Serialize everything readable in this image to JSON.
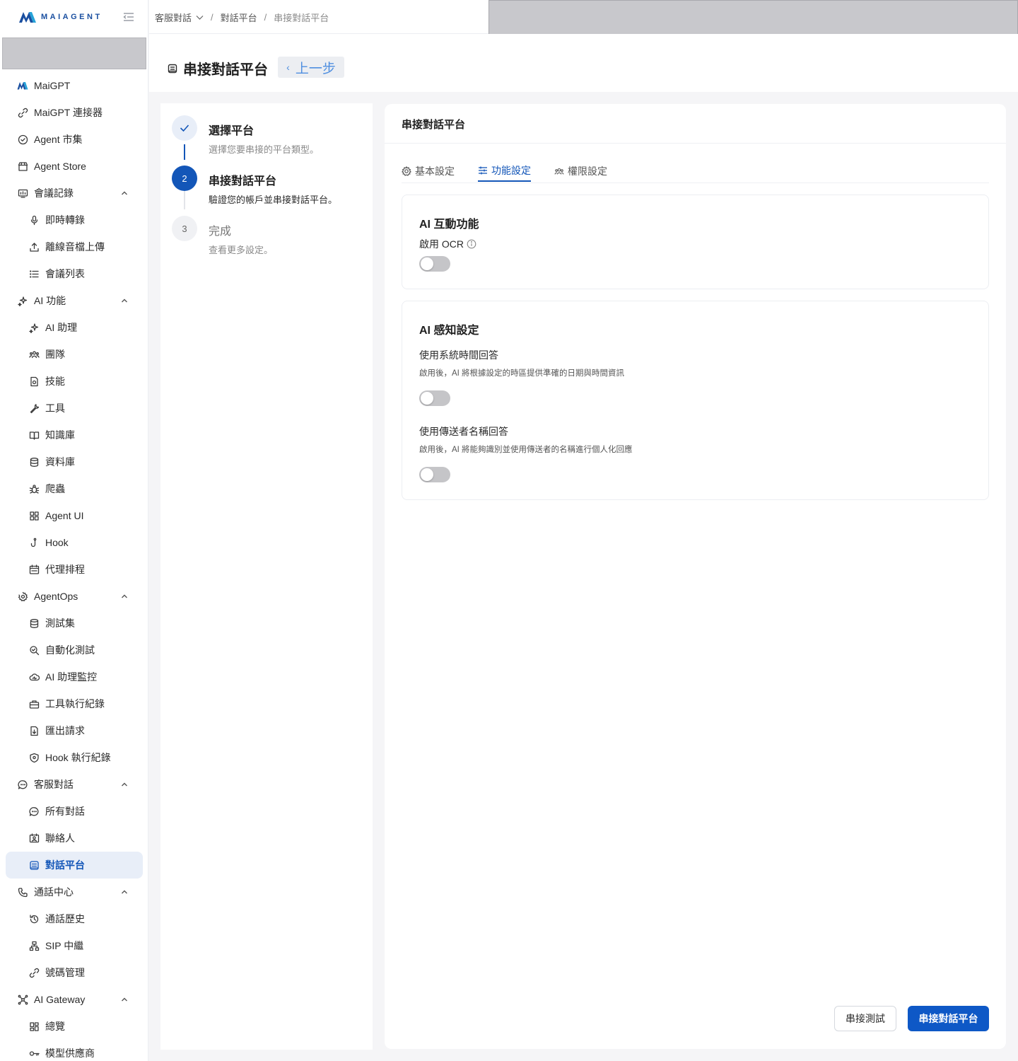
{
  "logo": {
    "text": "MAIAGENT"
  },
  "sidebar": {
    "items": [
      {
        "label": "MaiGPT",
        "icon": "maigpt-logo-icon",
        "level": 1
      },
      {
        "label": "MaiGPT 連接器",
        "icon": "link-icon",
        "level": 1
      },
      {
        "label": "Agent 市集",
        "icon": "badge-check-icon",
        "level": 1
      },
      {
        "label": "Agent Store",
        "icon": "store-icon",
        "level": 1
      },
      {
        "label": "會議記錄",
        "icon": "meeting-icon",
        "level": 1,
        "expanded": true
      },
      {
        "label": "即時轉錄",
        "icon": "microphone-icon",
        "level": 2
      },
      {
        "label": "離線音檔上傳",
        "icon": "upload-icon",
        "level": 2
      },
      {
        "label": "會議列表",
        "icon": "list-icon",
        "level": 2
      },
      {
        "label": "AI 功能",
        "icon": "sparkles-icon",
        "level": 1,
        "expanded": true
      },
      {
        "label": "AI 助理",
        "icon": "sparkles-icon",
        "level": 2
      },
      {
        "label": "團隊",
        "icon": "team-icon",
        "level": 2
      },
      {
        "label": "技能",
        "icon": "skill-file-icon",
        "level": 2
      },
      {
        "label": "工具",
        "icon": "wrench-icon",
        "level": 2
      },
      {
        "label": "知識庫",
        "icon": "book-icon",
        "level": 2
      },
      {
        "label": "資料庫",
        "icon": "database-icon",
        "level": 2
      },
      {
        "label": "爬蟲",
        "icon": "bug-icon",
        "level": 2
      },
      {
        "label": "Agent UI",
        "icon": "grid-icon",
        "level": 2
      },
      {
        "label": "Hook",
        "icon": "hook-icon",
        "level": 2
      },
      {
        "label": "代理排程",
        "icon": "calendar-icon",
        "level": 2
      },
      {
        "label": "AgentOps",
        "icon": "gear-cycle-icon",
        "level": 1,
        "expanded": true
      },
      {
        "label": "測試集",
        "icon": "database-icon",
        "level": 2
      },
      {
        "label": "自動化測試",
        "icon": "search-check-icon",
        "level": 2
      },
      {
        "label": "AI 助理監控",
        "icon": "cloud-monitor-icon",
        "level": 2
      },
      {
        "label": "工具執行紀錄",
        "icon": "toolbox-icon",
        "level": 2
      },
      {
        "label": "匯出請求",
        "icon": "export-file-icon",
        "level": 2
      },
      {
        "label": "Hook 執行紀錄",
        "icon": "shield-icon",
        "level": 2
      },
      {
        "label": "客服對話",
        "icon": "chat-icon",
        "level": 1,
        "expanded": true
      },
      {
        "label": "所有對話",
        "icon": "chat-icon",
        "level": 2
      },
      {
        "label": "聯絡人",
        "icon": "contact-icon",
        "level": 2
      },
      {
        "label": "對話平台",
        "icon": "platform-icon",
        "level": 2,
        "active": true
      },
      {
        "label": "通話中心",
        "icon": "phone-icon",
        "level": 1,
        "expanded": true
      },
      {
        "label": "通話歷史",
        "icon": "history-icon",
        "level": 2
      },
      {
        "label": "SIP 中繼",
        "icon": "network-icon",
        "level": 2
      },
      {
        "label": "號碼管理",
        "icon": "link-icon",
        "level": 2
      },
      {
        "label": "AI Gateway",
        "icon": "hub-icon",
        "level": 1,
        "expanded": true
      },
      {
        "label": "總覽",
        "icon": "dashboard-icon",
        "level": 2
      },
      {
        "label": "模型供應商",
        "icon": "key-icon",
        "level": 2
      }
    ]
  },
  "breadcrumb": {
    "items": [
      "客服對話",
      "對話平台",
      "串接對話平台"
    ]
  },
  "page": {
    "title": "串接對話平台",
    "back_label": "上一步"
  },
  "steps": [
    {
      "index": "✓",
      "title": "選擇平台",
      "desc": "選擇您要串接的平台類型。",
      "state": "done"
    },
    {
      "index": "2",
      "title": "串接對話平台",
      "desc": "驗證您的帳戶並串接對話平台。",
      "state": "current"
    },
    {
      "index": "3",
      "title": "完成",
      "desc": "查看更多設定。",
      "state": "pending"
    }
  ],
  "card": {
    "title": "串接對話平台",
    "tabs": [
      {
        "label": "基本設定",
        "icon": "gear-icon",
        "active": false
      },
      {
        "label": "功能設定",
        "icon": "sliders-icon",
        "active": true
      },
      {
        "label": "權限設定",
        "icon": "users-icon",
        "active": false
      }
    ],
    "sections": [
      {
        "title": "AI 互動功能",
        "fields": [
          {
            "label": "啟用 OCR",
            "desc": "",
            "enabled": false
          }
        ]
      },
      {
        "title": "AI 感知設定",
        "fields": [
          {
            "label": "使用系統時間回答",
            "desc": "啟用後，AI 將根據設定的時區提供準確的日期與時間資訊",
            "enabled": false
          },
          {
            "label": "使用傳送者名稱回答",
            "desc": "啟用後，AI 將能夠識別並使用傳送者的名稱進行個人化回應",
            "enabled": false
          }
        ]
      }
    ],
    "test_button": "串接測試",
    "submit_button": "串接對話平台"
  },
  "colors": {
    "primary": "#0e58c6",
    "active_bg": "#e8eef8",
    "toggle_off": "#c5c5c8"
  }
}
